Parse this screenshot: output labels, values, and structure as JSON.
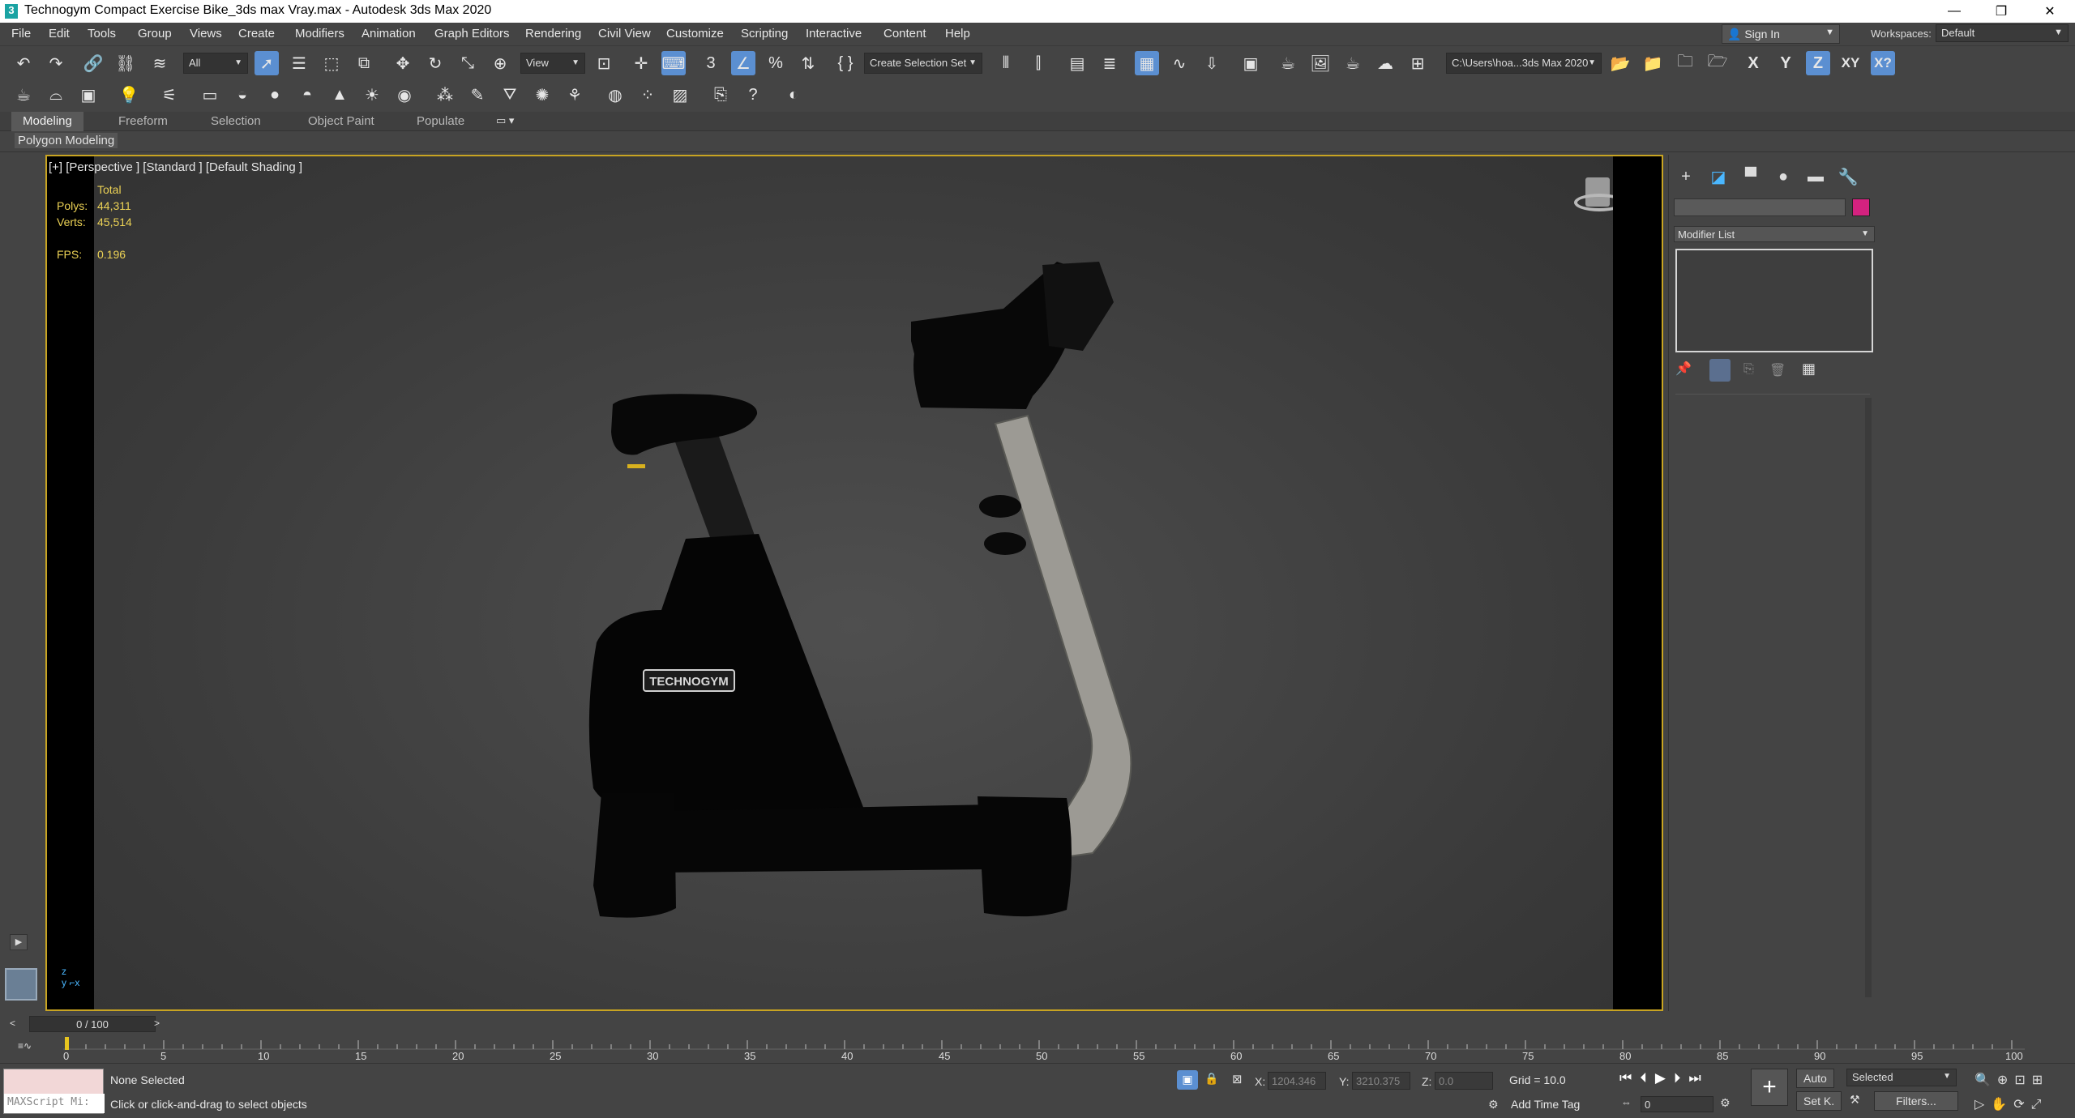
{
  "window": {
    "title": "Technogym Compact Exercise Bike_3ds max Vray.max - Autodesk 3ds Max 2020",
    "app_icon": "3",
    "minimize": "—",
    "maximize": "❐",
    "close": "✕"
  },
  "menu": [
    "File",
    "Edit",
    "Tools",
    "Group",
    "Views",
    "Create",
    "Modifiers",
    "Animation",
    "Graph Editors",
    "Rendering",
    "Civil View",
    "Customize",
    "Scripting",
    "Interactive",
    "Content",
    "Help"
  ],
  "account": {
    "sign_in": "Sign In",
    "workspaces_label": "Workspaces:",
    "workspace_value": "Default"
  },
  "toolbar": {
    "selection_filter": "All",
    "ref_coord": "View",
    "named_selection": "Create Selection Set",
    "project_path": "C:\\Users\\hoa...3ds Max 2020",
    "axis_x": "X",
    "axis_y": "Y",
    "axis_z": "Z",
    "axis_xy": "XY",
    "axis_xyz": "X?"
  },
  "ribbon": {
    "tabs": [
      "Modeling",
      "Freeform",
      "Selection",
      "Object Paint",
      "Populate"
    ],
    "active_tab": "Modeling",
    "panel_label": "Polygon Modeling"
  },
  "viewport": {
    "label": "[+] [Perspective ] [Standard ] [Default Shading ]",
    "stats": {
      "total_label": "Total",
      "polys_label": "Polys:",
      "polys_value": "44,311",
      "verts_label": "Verts:",
      "verts_value": "45,514",
      "fps_label": "FPS:",
      "fps_value": "0.196"
    },
    "brand_text": "TECHNOGYM"
  },
  "command_panel": {
    "modifier_list": "Modifier List"
  },
  "timeline": {
    "frame_display": "0 / 100",
    "ticks": [
      "0",
      "5",
      "10",
      "15",
      "20",
      "25",
      "30",
      "35",
      "40",
      "45",
      "50",
      "55",
      "60",
      "65",
      "70",
      "75",
      "80",
      "85",
      "90",
      "95",
      "100"
    ]
  },
  "status": {
    "maxscript": "MAXScript Mi:",
    "selection": "None Selected",
    "prompt": "Click or click-and-drag to select objects",
    "x_label": "X:",
    "x_value": "1204.346",
    "y_label": "Y:",
    "y_value": "3210.375",
    "z_label": "Z:",
    "z_value": "0.0",
    "grid": "Grid = 10.0",
    "add_time_tag": "Add Time Tag",
    "auto_key": "Auto",
    "set_key": "Set K.",
    "key_mode": "Selected",
    "filters": "Filters...",
    "current_frame": "0"
  },
  "colors": {
    "accent": "#5b8fd1",
    "viewport_border": "#c8a422",
    "stats_text": "#ecd255",
    "object_color": "#d4227f"
  }
}
